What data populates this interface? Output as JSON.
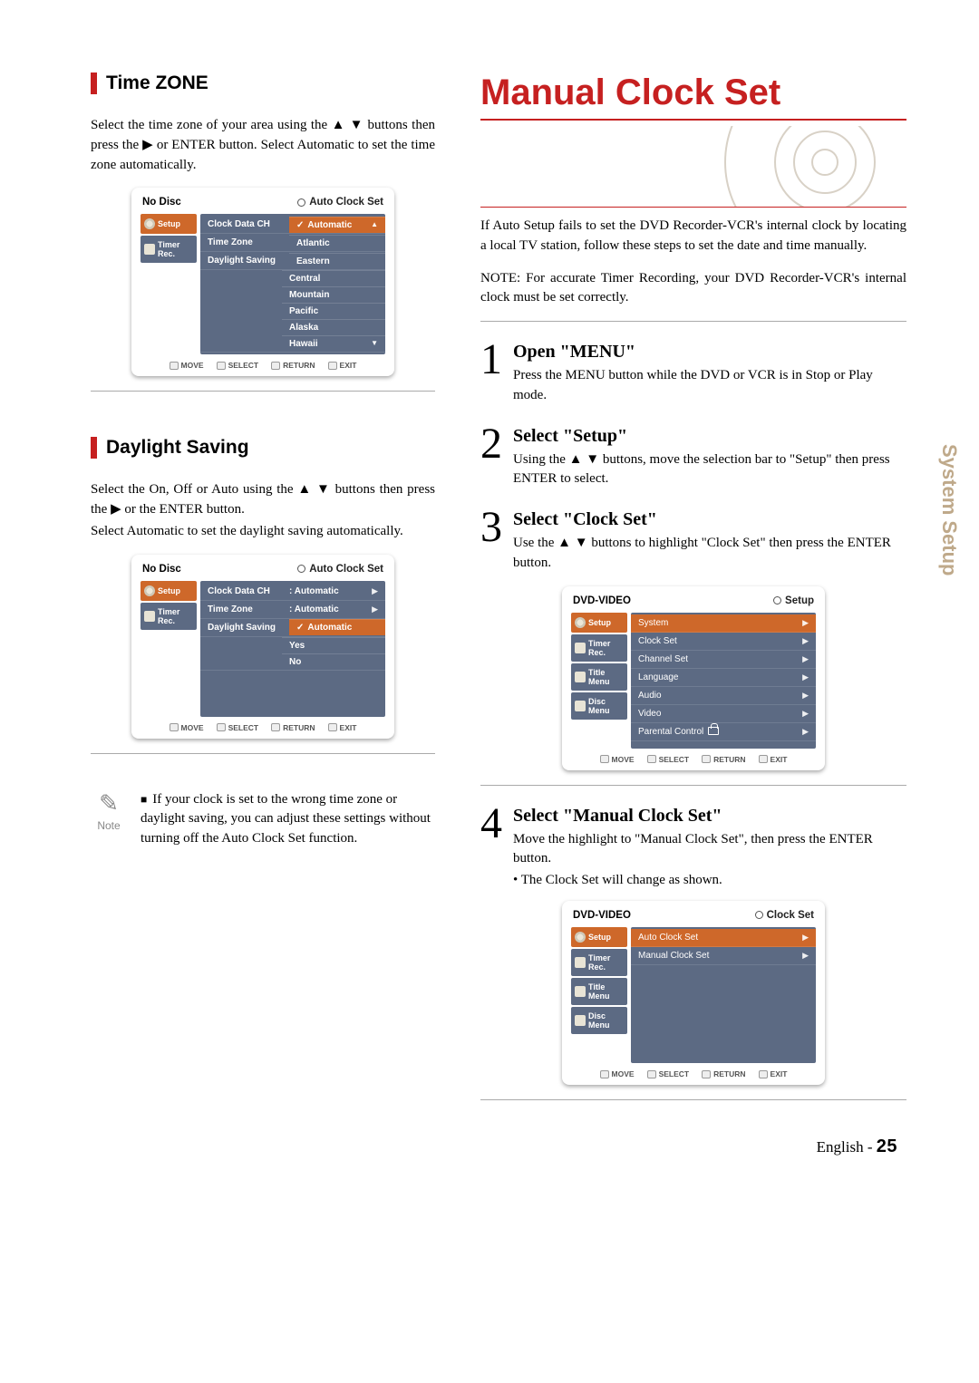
{
  "side_tab": "System Setup",
  "left": {
    "timezone": {
      "heading": "Time ZONE",
      "text": "Select the time zone of your area using the ▲ ▼ buttons then press the ▶ or ENTER button. Select Automatic to set the time zone automatically."
    },
    "daylight": {
      "heading": "Daylight Saving",
      "text1": "Select the On, Off or Auto using the ▲ ▼ buttons then press the ▶ or the ENTER button.",
      "text2": "Select Automatic to set the daylight saving automatically."
    },
    "note": {
      "label": "Note",
      "text": "If your clock is set to the wrong time zone or daylight saving, you can adjust these settings without turning off the Auto Clock Set function."
    }
  },
  "right": {
    "title": "Manual Clock Set",
    "intro": "If Auto Setup fails to set the DVD Recorder-VCR's internal clock by locating a local TV station, follow these steps to set the date and time manually.",
    "note": "NOTE: For accurate Timer Recording, your DVD Recorder-VCR's internal clock must be set correctly.",
    "steps": {
      "s1": {
        "num": "1",
        "title": "Open \"MENU\"",
        "text": "Press the MENU button while the DVD or VCR is in Stop or Play mode."
      },
      "s2": {
        "num": "2",
        "title": "Select \"Setup\"",
        "text": "Using the ▲ ▼ buttons, move the selection bar to \"Setup\" then press ENTER to select."
      },
      "s3": {
        "num": "3",
        "title": "Select \"Clock Set\"",
        "text": "Use the ▲ ▼ buttons to highlight \"Clock Set\" then press the ENTER button."
      },
      "s4": {
        "num": "4",
        "title": "Select \"Manual Clock Set\"",
        "text": "Move the highlight to \"Manual Clock Set\", then press the ENTER button.",
        "bullet": "• The Clock Set will change as shown."
      }
    }
  },
  "osd_bar": {
    "move": "MOVE",
    "select": "SELECT",
    "return": "RETURN",
    "exit": "EXIT"
  },
  "osd1": {
    "left_title": "No Disc",
    "right_title": "Auto Clock Set",
    "sidebar": {
      "setup": "Setup",
      "timer": "Timer Rec."
    },
    "rows": {
      "r0": "Clock Data CH",
      "r1": "Time Zone",
      "r2": "Daylight Saving"
    },
    "sublist": {
      "i0": "Automatic",
      "i1": "Atlantic",
      "i2": "Eastern",
      "i3": "Central",
      "i4": "Mountain",
      "i5": "Pacific",
      "i6": "Alaska",
      "i7": "Hawaii"
    }
  },
  "osd2": {
    "left_title": "No Disc",
    "right_title": "Auto Clock Set",
    "sidebar": {
      "setup": "Setup",
      "timer": "Timer Rec."
    },
    "rows": {
      "r0l": "Clock Data CH",
      "r0v": ": Automatic",
      "r1l": "Time Zone",
      "r1v": ": Automatic",
      "r2l": "Daylight Saving"
    },
    "sublist": {
      "i0": "Automatic",
      "i1": "Yes",
      "i2": "No"
    }
  },
  "osd3": {
    "left_title": "DVD-VIDEO",
    "right_title": "Setup",
    "sidebar": {
      "setup": "Setup",
      "timer": "Timer Rec.",
      "title": "Title Menu",
      "disc": "Disc Menu"
    },
    "rows": {
      "r0": "System",
      "r1": "Clock Set",
      "r2": "Channel Set",
      "r3": "Language",
      "r4": "Audio",
      "r5": "Video",
      "r6": "Parental Control"
    }
  },
  "osd4": {
    "left_title": "DVD-VIDEO",
    "right_title": "Clock Set",
    "sidebar": {
      "setup": "Setup",
      "timer": "Timer Rec.",
      "title": "Title Menu",
      "disc": "Disc Menu"
    },
    "rows": {
      "r0": "Auto Clock Set",
      "r1": "Manual Clock Set"
    }
  },
  "footer": {
    "lang": "English - ",
    "page": "25"
  }
}
